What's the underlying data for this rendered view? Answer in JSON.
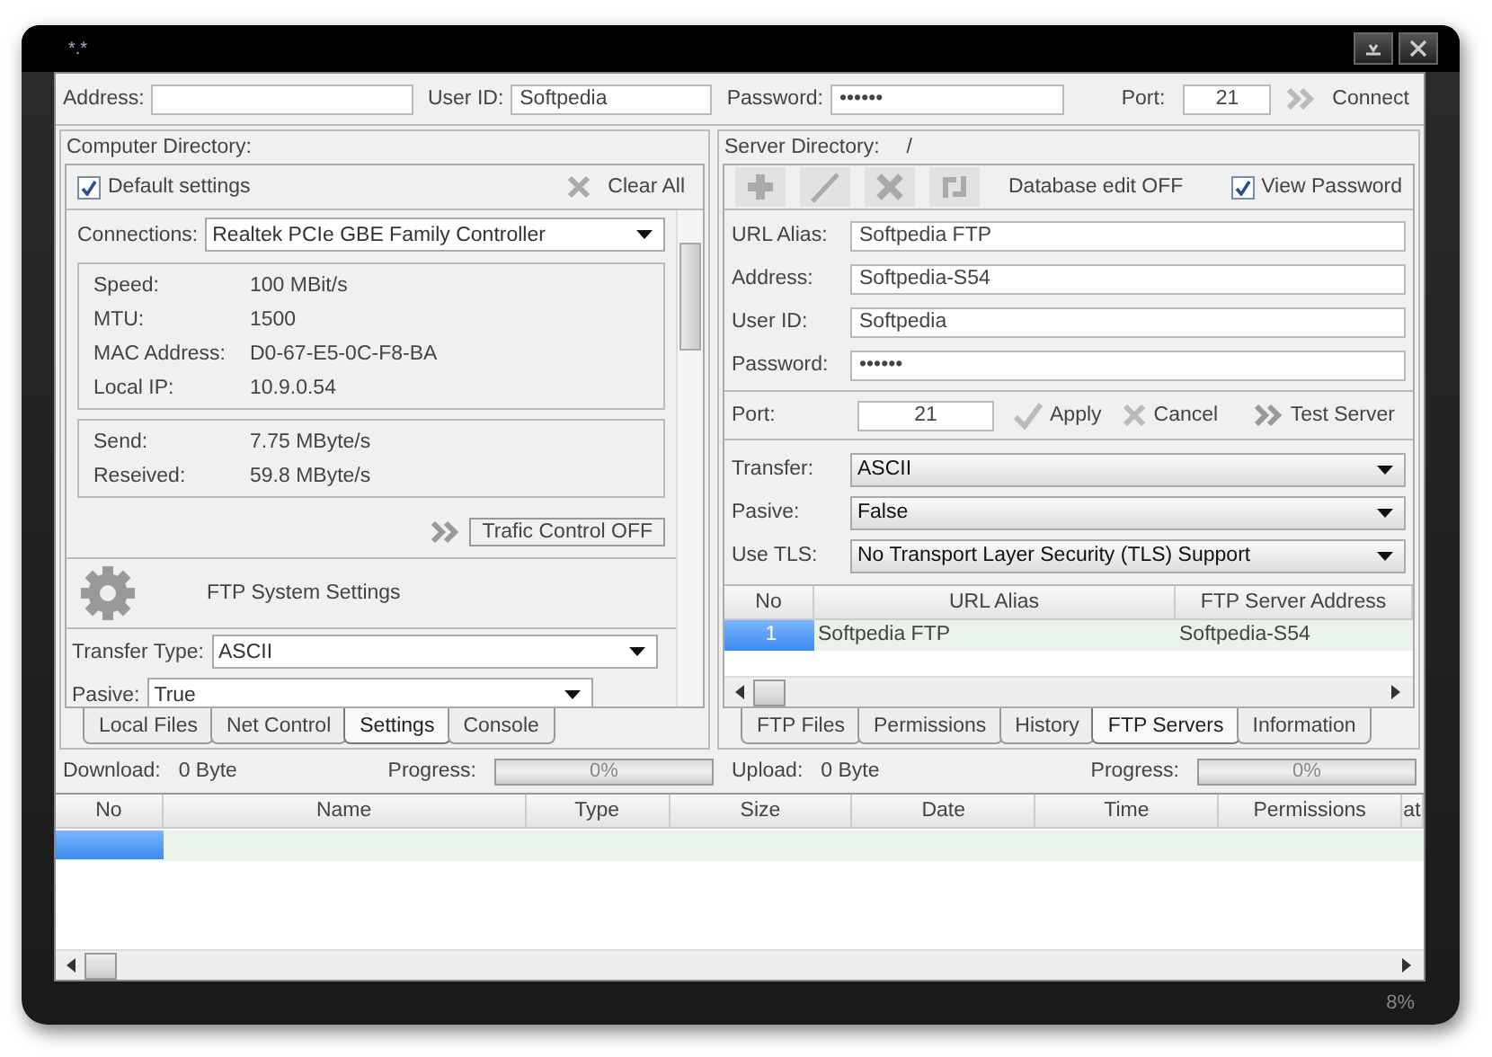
{
  "window": {
    "title": "*.*",
    "zoom": "8%"
  },
  "top_bar": {
    "fields": [
      {
        "label": "Address:"
      },
      {
        "label": "User ID:",
        "value": "Softpedia"
      },
      {
        "label": "Password:",
        "value": "••••••"
      },
      {
        "label": "Port:",
        "value": "21"
      }
    ],
    "connect": "Connect"
  },
  "computer_directory": {
    "title": "Computer Directory:",
    "default_settings": {
      "label": "Default settings",
      "checked": true
    },
    "clear_all": "Clear All",
    "connections": {
      "label": "Connections:",
      "value": "Realtek PCIe GBE Family Controller"
    },
    "info": [
      {
        "label": "Speed:",
        "value": "100 MBit/s"
      },
      {
        "label": "MTU:",
        "value": "1500"
      },
      {
        "label": "MAC Address:",
        "value": "D0-67-E5-0C-F8-BA"
      },
      {
        "label": "Local IP:",
        "value": "10.9.0.54"
      }
    ],
    "rates": [
      {
        "label": "Send:",
        "value": "7.75 MByte/s"
      },
      {
        "label": "Reseived:",
        "value": "59.8 MByte/s"
      }
    ],
    "trafic_control": "Trafic Control OFF",
    "section": "FTP System Settings",
    "settings": [
      {
        "label": "Transfer Type:",
        "value": "ASCII"
      },
      {
        "label": "Pasive:",
        "value": "True"
      }
    ],
    "tabs": [
      {
        "label": "Local Files",
        "selected": false
      },
      {
        "label": "Net Control",
        "selected": false
      },
      {
        "label": "Settings",
        "selected": true
      },
      {
        "label": "Console",
        "selected": false
      }
    ]
  },
  "server_directory": {
    "title": "Server Directory:",
    "path": "/",
    "database_edit": "Database edit OFF",
    "view_password": {
      "label": "View Password",
      "checked": true
    },
    "fields": [
      {
        "label": "URL Alias:",
        "value": "Softpedia FTP"
      },
      {
        "label": "Address:",
        "value": "Softpedia-S54"
      },
      {
        "label": "User ID:",
        "value": "Softpedia"
      },
      {
        "label": "Password:",
        "value": "••••••"
      }
    ],
    "port": {
      "label": "Port:",
      "value": "21"
    },
    "actions": [
      {
        "kind": "apply",
        "label": "Apply"
      },
      {
        "kind": "cancel",
        "label": "Cancel"
      },
      {
        "kind": "test",
        "label": "Test Server"
      }
    ],
    "selects": [
      {
        "label": "Transfer:",
        "value": "ASCII"
      },
      {
        "label": "Pasive:",
        "value": "False"
      },
      {
        "label": "Use TLS:",
        "value": "No Transport Layer Security (TLS) Support"
      }
    ],
    "table": {
      "columns": [
        "No",
        "URL Alias",
        "FTP Server Address"
      ],
      "rows": [
        {
          "selected": true,
          "cells": [
            "1",
            "Softpedia FTP",
            "Softpedia-S54"
          ]
        }
      ]
    },
    "tabs": [
      {
        "label": "FTP Files",
        "selected": false
      },
      {
        "label": "Permissions",
        "selected": false
      },
      {
        "label": "History",
        "selected": false
      },
      {
        "label": "FTP Servers",
        "selected": true
      },
      {
        "label": "Information",
        "selected": false
      }
    ]
  },
  "transfers": [
    {
      "label": "Download:",
      "value": "0 Byte",
      "progress_label": "Progress:",
      "progress_text": "0%",
      "level": 0
    },
    {
      "label": "Upload:",
      "value": "0 Byte",
      "progress_label": "Progress:",
      "progress_text": "0%",
      "level": 0
    }
  ],
  "files_table": {
    "columns": [
      "No",
      "Name",
      "Type",
      "Size",
      "Date",
      "Time",
      "Permissions",
      "at"
    ],
    "rows": [
      {
        "selected": true
      }
    ]
  }
}
